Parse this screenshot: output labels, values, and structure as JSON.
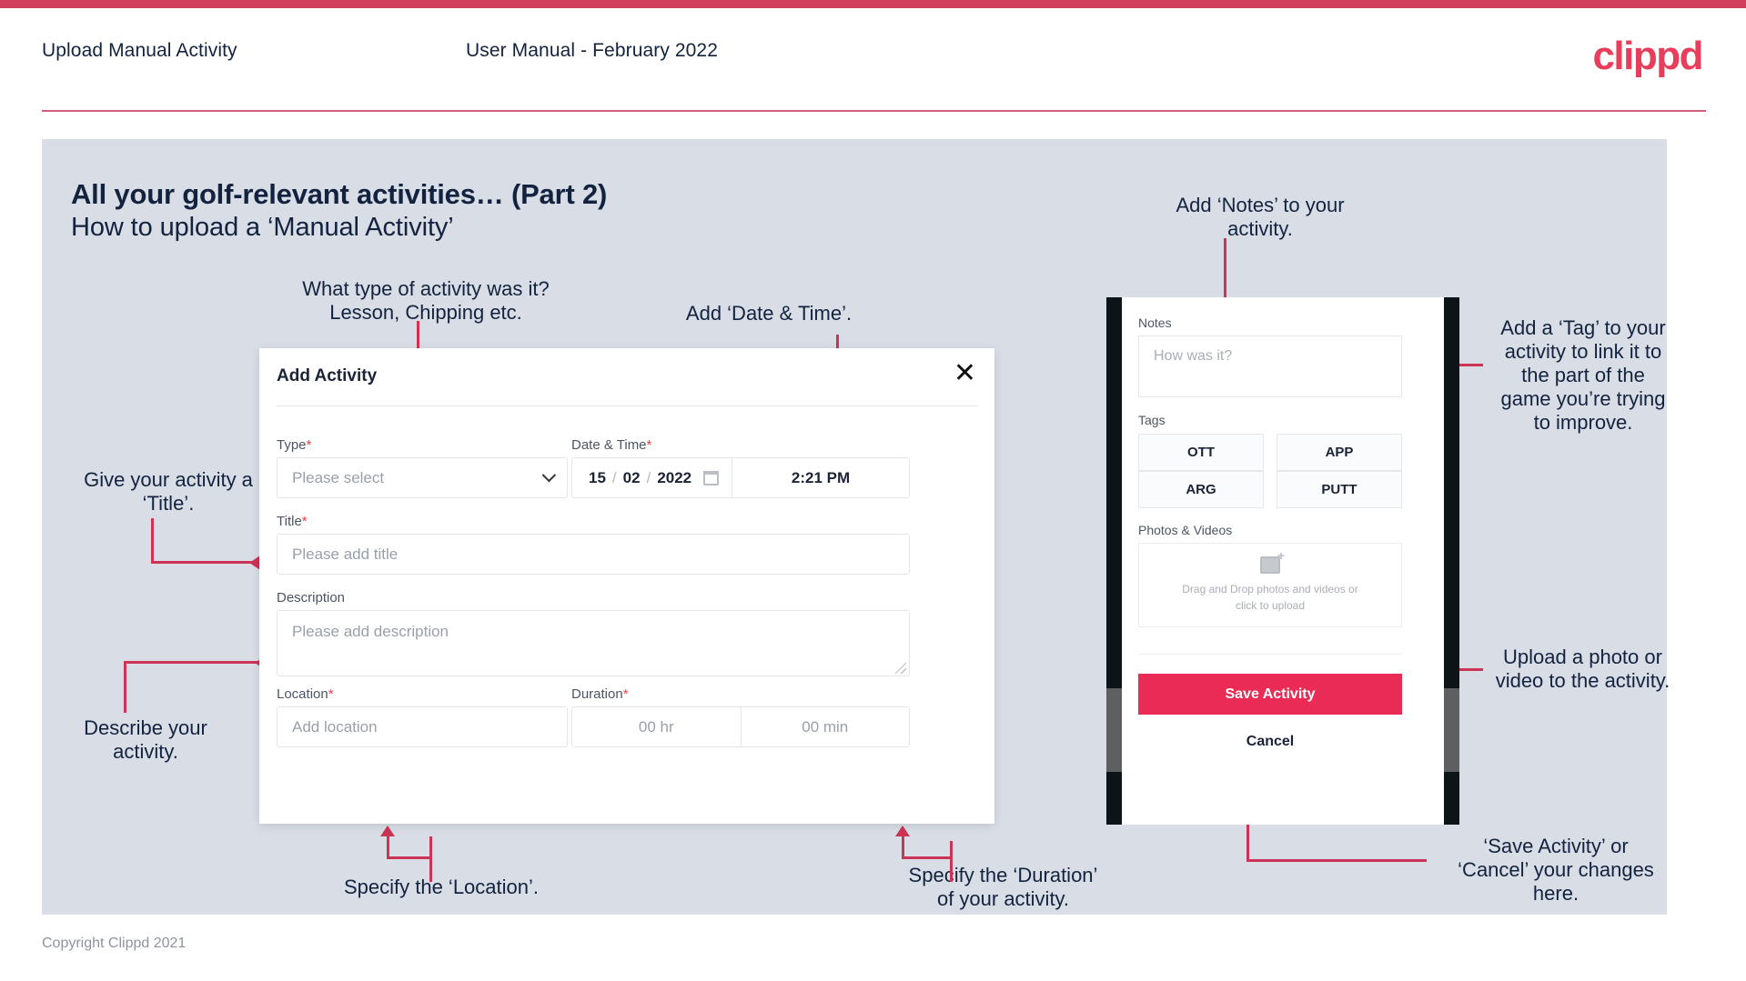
{
  "header": {
    "title": "Upload Manual Activity",
    "subtitle": "User Manual - February 2022",
    "logo": "clippd"
  },
  "slide": {
    "title": "All your golf-relevant activities… (Part 2)",
    "subtitle": "How to upload a ‘Manual Activity’"
  },
  "annotations": {
    "type": "What type of activity was it?\nLesson, Chipping etc.",
    "datetime": "Add ‘Date & Time’.",
    "title": "Give your activity a\n‘Title’.",
    "description": "Describe your\nactivity.",
    "location": "Specify the ‘Location’.",
    "duration": "Specify the ‘Duration’\nof your activity.",
    "notes": "Add ‘Notes’ to your\nactivity.",
    "tags": "Add a ‘Tag’ to your\nactivity to link it to\nthe part of the\ngame you’re trying\nto improve.",
    "photos": "Upload a photo or\nvideo to the activity.",
    "save": "‘Save Activity’ or\n‘Cancel’ your changes\nhere."
  },
  "dialog": {
    "title": "Add Activity",
    "close_icon": "close-icon",
    "fields": {
      "type": {
        "label": "Type",
        "required": "*",
        "placeholder": "Please select"
      },
      "datetime": {
        "label": "Date & Time",
        "required": "*",
        "day": "15",
        "month": "02",
        "year": "2022",
        "sep1": "/",
        "sep2": "/",
        "time": "2:21 PM"
      },
      "title": {
        "label": "Title",
        "required": "*",
        "placeholder": "Please add title"
      },
      "description": {
        "label": "Description",
        "required": "",
        "placeholder": "Please add description"
      },
      "location": {
        "label": "Location",
        "required": "*",
        "placeholder": "Add location"
      },
      "duration": {
        "label": "Duration",
        "required": "*",
        "hours": "00 hr",
        "minutes": "00 min"
      }
    }
  },
  "phone": {
    "notes": {
      "label": "Notes",
      "placeholder": "How was it?"
    },
    "tags": {
      "label": "Tags",
      "items": [
        "OTT",
        "APP",
        "ARG",
        "PUTT"
      ]
    },
    "photos": {
      "label": "Photos & Videos",
      "dropzone_line1": "Drag and Drop photos and videos or",
      "dropzone_line2": "click to upload"
    },
    "save_label": "Save Activity",
    "cancel_label": "Cancel"
  },
  "footer": {
    "copyright": "Copyright Clippd 2021"
  },
  "colors": {
    "brand_crimson": "#e83e5c",
    "top_bar": "#d0405c",
    "slide_bg": "#d9dee6",
    "ink": "#13233f",
    "arrow": "#cc3355",
    "save_button": "#ea2b55",
    "required_star": "#ec4040"
  }
}
